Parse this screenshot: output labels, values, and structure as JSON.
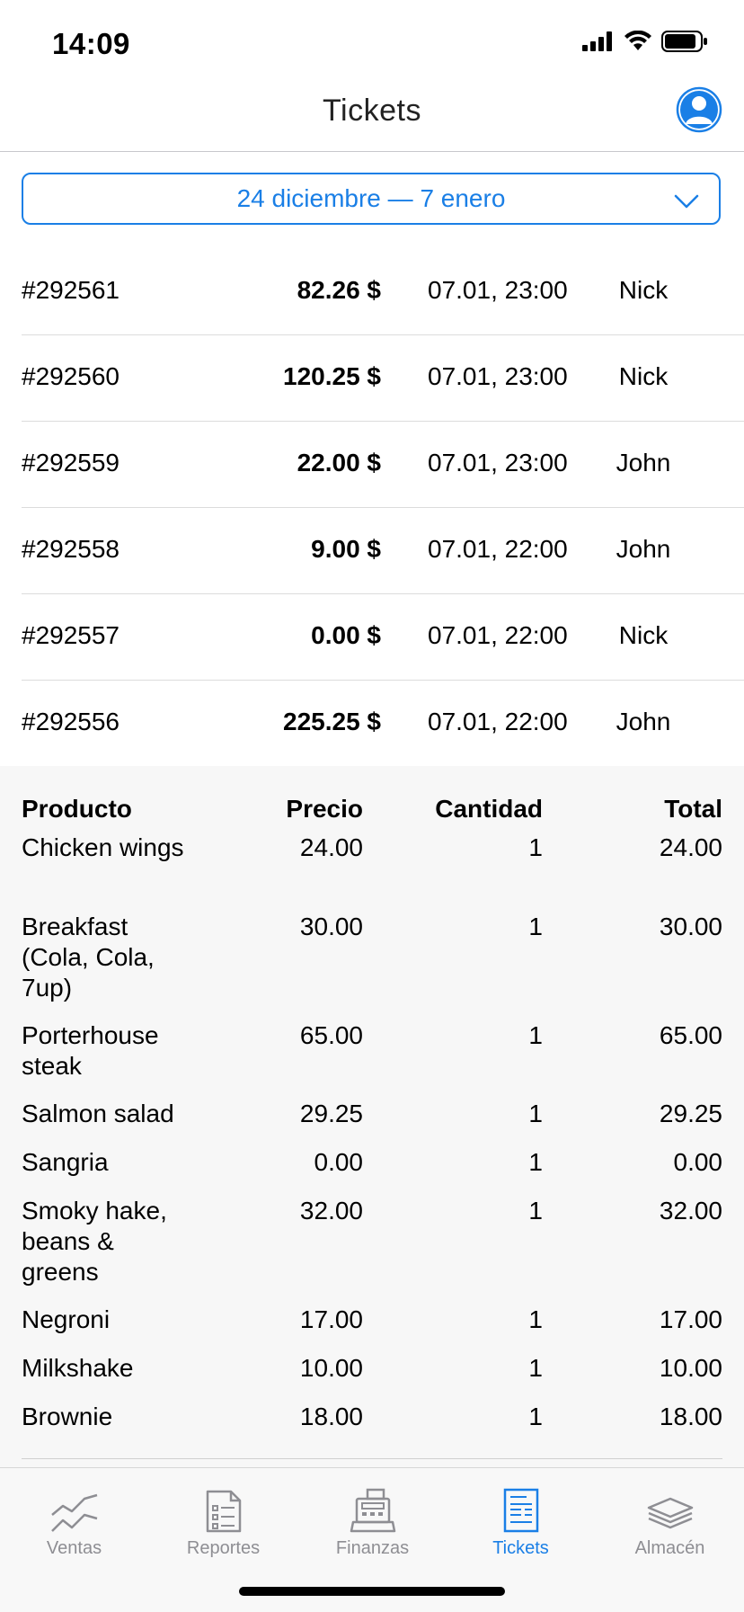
{
  "status_bar": {
    "time": "14:09"
  },
  "header": {
    "title": "Tickets"
  },
  "date_range": {
    "label": "24 diciembre — 7 enero"
  },
  "tickets": [
    {
      "id": "#292561",
      "amount": "82.26 $",
      "datetime": "07.01, 23:00",
      "user": "Nick"
    },
    {
      "id": "#292560",
      "amount": "120.25 $",
      "datetime": "07.01, 23:00",
      "user": "Nick"
    },
    {
      "id": "#292559",
      "amount": "22.00 $",
      "datetime": "07.01, 23:00",
      "user": "John"
    },
    {
      "id": "#292558",
      "amount": "9.00 $",
      "datetime": "07.01, 22:00",
      "user": "John"
    },
    {
      "id": "#292557",
      "amount": "0.00 $",
      "datetime": "07.01, 22:00",
      "user": "Nick"
    },
    {
      "id": "#292556",
      "amount": "225.25 $",
      "datetime": "07.01, 22:00",
      "user": "John"
    }
  ],
  "detail": {
    "headers": {
      "product": "Producto",
      "price": "Precio",
      "quantity": "Cantidad",
      "total": "Total"
    },
    "items": [
      {
        "product": "Chicken wings",
        "price": "24.00",
        "quantity": "1",
        "total": "24.00"
      },
      {
        "product": "Breakfast (Cola, Cola, 7up)",
        "price": "30.00",
        "quantity": "1",
        "total": "30.00"
      },
      {
        "product": "Porterhouse steak",
        "price": "65.00",
        "quantity": "1",
        "total": "65.00"
      },
      {
        "product": "Salmon salad",
        "price": "29.25",
        "quantity": "1",
        "total": "29.25"
      },
      {
        "product": "Sangria",
        "price": "0.00",
        "quantity": "1",
        "total": "0.00"
      },
      {
        "product": "Smoky hake, beans & greens",
        "price": "32.00",
        "quantity": "1",
        "total": "32.00"
      },
      {
        "product": "Negroni",
        "price": "17.00",
        "quantity": "1",
        "total": "17.00"
      },
      {
        "product": "Milkshake",
        "price": "10.00",
        "quantity": "1",
        "total": "10.00"
      },
      {
        "product": "Brownie",
        "price": "18.00",
        "quantity": "1",
        "total": "18.00"
      }
    ]
  },
  "tabbar": {
    "items": [
      {
        "label": "Ventas",
        "icon": "chart-line-icon",
        "active": false
      },
      {
        "label": "Reportes",
        "icon": "document-list-icon",
        "active": false
      },
      {
        "label": "Finanzas",
        "icon": "cash-register-icon",
        "active": false
      },
      {
        "label": "Tickets",
        "icon": "ticket-receipt-icon",
        "active": true
      },
      {
        "label": "Almacén",
        "icon": "layers-stack-icon",
        "active": false
      }
    ]
  },
  "colors": {
    "accent": "#1a7fe6",
    "inactive": "#8e8e93",
    "detail_bg": "#f7f7f7"
  }
}
